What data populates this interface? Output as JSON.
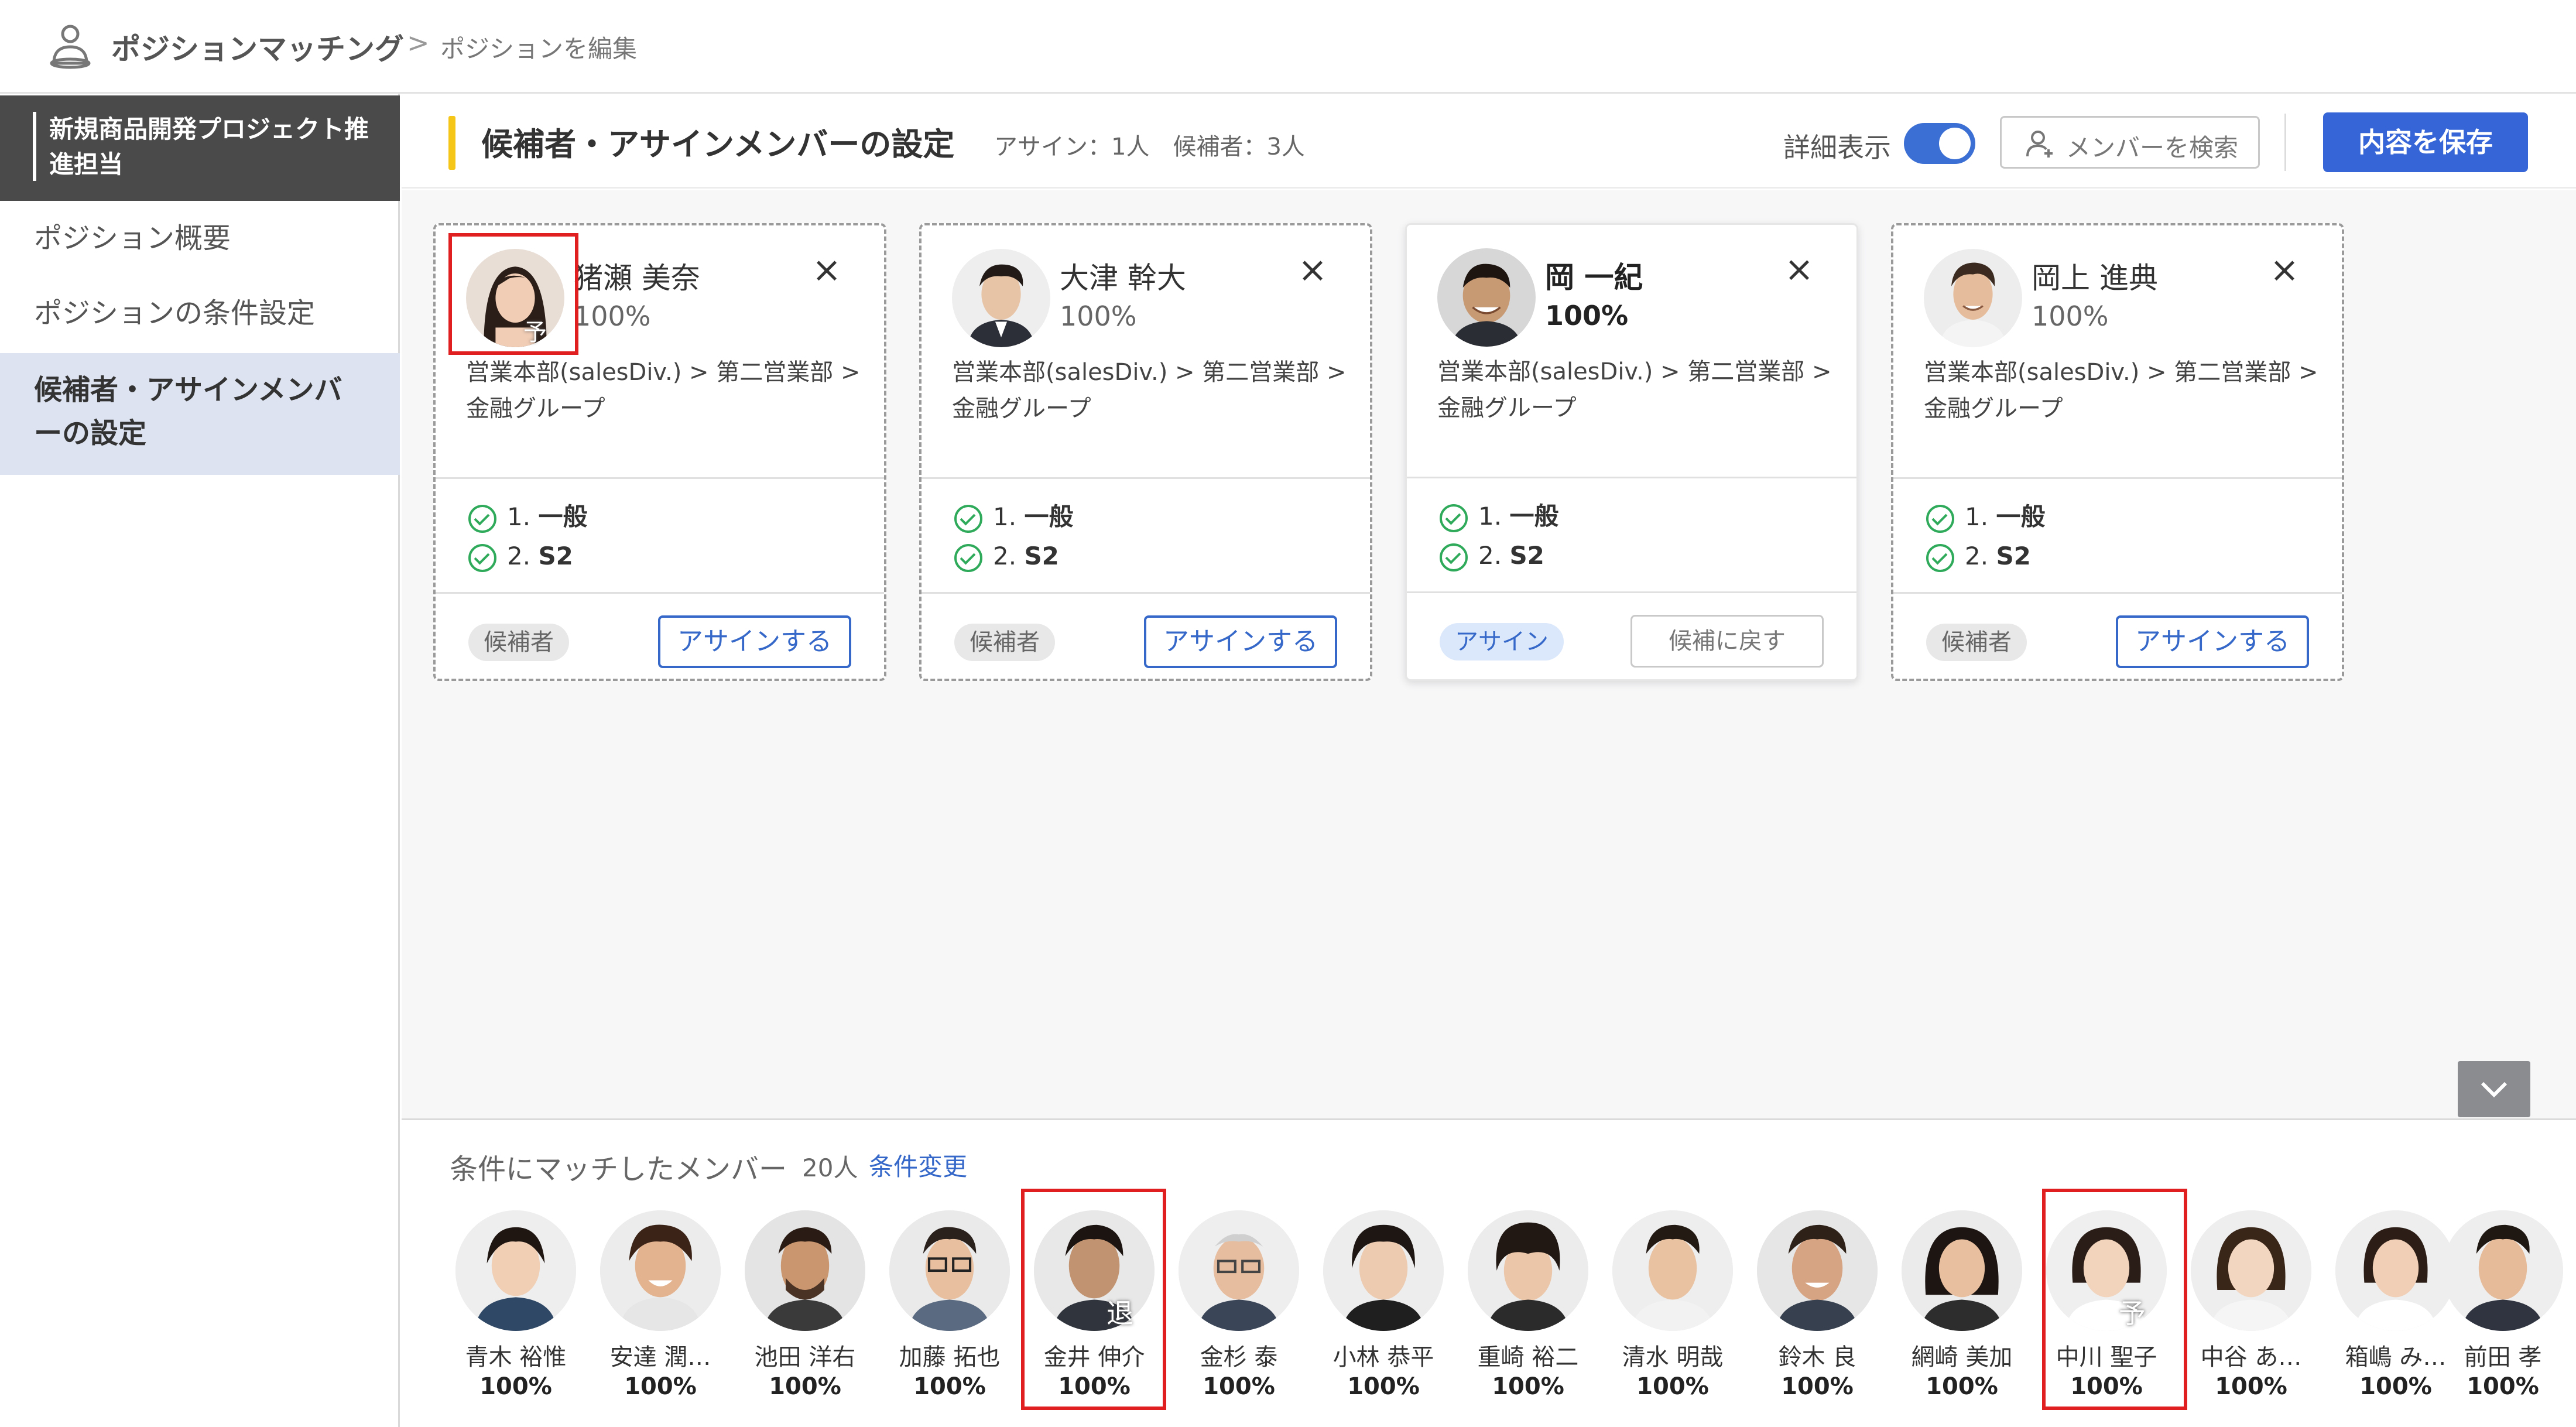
{
  "app": {
    "title": "ポジションマッチング",
    "breadcrumb_sep": ">",
    "page": "ポジションを編集"
  },
  "sidebar": {
    "project": "新規商品開発プロジェクト推進担当",
    "items": [
      {
        "label": "ポジション概要"
      },
      {
        "label": "ポジションの条件設定"
      },
      {
        "label": "候補者・アサインメンバーの設定"
      }
    ]
  },
  "panel": {
    "title": "候補者・アサインメンバーの設定",
    "counts": "アサイン：1人　候補者：3人",
    "detail_label": "詳細表示",
    "search_label": "メンバーを検索",
    "save_label": "内容を保存"
  },
  "cards": [
    {
      "name": "猪瀬 美奈",
      "pct": "100%",
      "badge": "予",
      "dept": "営業本部(salesDiv.) > 第二営業部 > 金融グループ",
      "cond1_num": "1.",
      "cond1": "一般",
      "cond2_num": "2.",
      "cond2": "S2",
      "status": "候補者",
      "action": "アサインする",
      "close": "×"
    },
    {
      "name": "大津 幹大",
      "pct": "100%",
      "dept": "営業本部(salesDiv.) > 第二営業部 > 金融グループ",
      "cond1_num": "1.",
      "cond1": "一般",
      "cond2_num": "2.",
      "cond2": "S2",
      "status": "候補者",
      "action": "アサインする",
      "close": "×"
    },
    {
      "name": "岡 一紀",
      "pct": "100%",
      "dept": "営業本部(salesDiv.) > 第二営業部 > 金融グループ",
      "cond1_num": "1.",
      "cond1": "一般",
      "cond2_num": "2.",
      "cond2": "S2",
      "status": "アサイン",
      "action": "候補に戻す",
      "close": "×"
    },
    {
      "name": "岡上 進典",
      "pct": "100%",
      "dept": "営業本部(salesDiv.) > 第二営業部 > 金融グループ",
      "cond1_num": "1.",
      "cond1": "一般",
      "cond2_num": "2.",
      "cond2": "S2",
      "status": "候補者",
      "action": "アサインする",
      "close": "×"
    }
  ],
  "matched": {
    "title": "条件にマッチしたメンバー",
    "count": "20人",
    "change_label": "条件変更",
    "members": [
      {
        "name": "青木 裕惟",
        "pct": "100%"
      },
      {
        "name": "安達 潤…",
        "pct": "100%"
      },
      {
        "name": "池田 洋右",
        "pct": "100%"
      },
      {
        "name": "加藤 拓也",
        "pct": "100%"
      },
      {
        "name": "金井 伸介",
        "pct": "100%",
        "badge": "退"
      },
      {
        "name": "金杉 泰",
        "pct": "100%"
      },
      {
        "name": "小林 恭平",
        "pct": "100%"
      },
      {
        "name": "重崎 裕二",
        "pct": "100%"
      },
      {
        "name": "清水 明哉",
        "pct": "100%"
      },
      {
        "name": "鈴木 良",
        "pct": "100%"
      },
      {
        "name": "網崎 美加",
        "pct": "100%"
      },
      {
        "name": "中川 聖子",
        "pct": "100%",
        "badge": "予"
      },
      {
        "name": "中谷 あ…",
        "pct": "100%"
      },
      {
        "name": "箱嶋 み…",
        "pct": "100%"
      },
      {
        "name": "前田 孝",
        "pct": "100%"
      }
    ]
  },
  "colors": {
    "accent": "#3565d6",
    "highlight": "#e02020",
    "check": "#2eaa5a",
    "title_bar": "#f5c518"
  },
  "icons": [
    "user-icon",
    "close-icon",
    "check-circle-icon",
    "user-search-icon",
    "chevron-down-icon"
  ]
}
